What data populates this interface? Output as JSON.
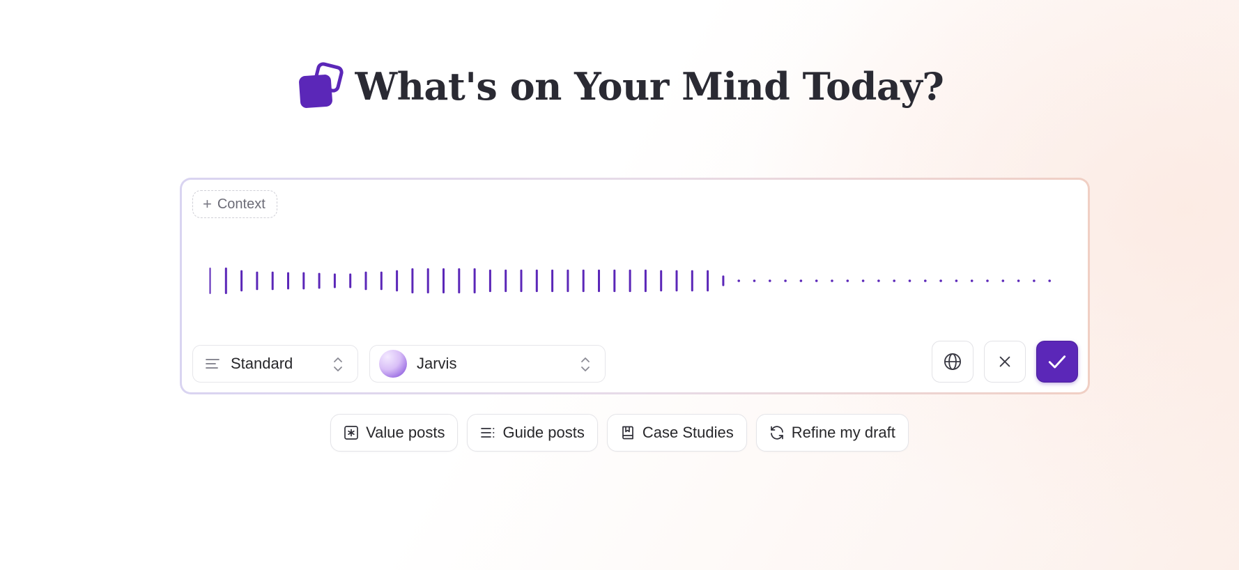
{
  "header": {
    "title": "What's on Your Mind Today?",
    "logo_icon": "stacked-squares-logo",
    "logo_color": "#5b27b8"
  },
  "composer": {
    "context_label": "Context",
    "recording_levels": [
      1,
      1,
      0.8,
      0.7,
      0.7,
      0.65,
      0.65,
      0.6,
      0.55,
      0.55,
      0.7,
      0.7,
      0.8,
      0.95,
      0.95,
      0.95,
      0.95,
      0.95,
      0.85,
      0.85,
      0.85,
      0.85,
      0.85,
      0.85,
      0.85,
      0.85,
      0.85,
      0.85,
      0.85,
      0.8,
      0.8,
      0.8,
      0.8,
      0.4
    ],
    "silent_dots": 21,
    "wave_color": "#5b27b8",
    "format_select": {
      "value": "Standard",
      "icon": "align-left-icon"
    },
    "persona_select": {
      "value": "Jarvis",
      "icon": "avatar"
    },
    "actions": {
      "globe_icon": "globe-icon",
      "cancel_icon": "close-icon",
      "confirm_icon": "check-icon"
    }
  },
  "suggestions": [
    {
      "label": "Value posts",
      "icon": "asterisk-square-icon"
    },
    {
      "label": "Guide posts",
      "icon": "list-icon"
    },
    {
      "label": "Case Studies",
      "icon": "bookmark-book-icon"
    },
    {
      "label": "Refine my draft",
      "icon": "refresh-icon"
    }
  ]
}
